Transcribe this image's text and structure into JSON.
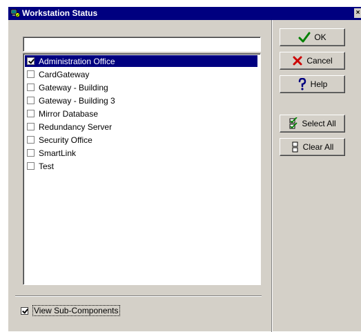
{
  "window": {
    "title": "Workstation Status",
    "close_glyph": "×"
  },
  "search": {
    "value": "",
    "placeholder": ""
  },
  "items": [
    {
      "label": "Administration Office",
      "checked": true,
      "selected": true
    },
    {
      "label": "CardGateway",
      "checked": false,
      "selected": false
    },
    {
      "label": "Gateway - Building",
      "checked": false,
      "selected": false
    },
    {
      "label": "Gateway - Building 3",
      "checked": false,
      "selected": false
    },
    {
      "label": "Mirror Database",
      "checked": false,
      "selected": false
    },
    {
      "label": "Redundancy Server",
      "checked": false,
      "selected": false
    },
    {
      "label": "Security Office",
      "checked": false,
      "selected": false
    },
    {
      "label": "SmartLink",
      "checked": false,
      "selected": false
    },
    {
      "label": "Test",
      "checked": false,
      "selected": false
    }
  ],
  "sub_components": {
    "label": "View Sub-Components",
    "checked": true
  },
  "buttons": {
    "ok": {
      "label": "OK",
      "icon": "checkmark-icon",
      "icon_color": "#008000"
    },
    "cancel": {
      "label": "Cancel",
      "icon": "x-icon",
      "icon_color": "#cc0000"
    },
    "help": {
      "label": "Help",
      "icon": "question-mark-icon",
      "icon_color": "#000080"
    },
    "select_all": {
      "label": "Select All",
      "icon": "select-all-icon",
      "icon_color": "#008000"
    },
    "clear_all": {
      "label": "Clear All",
      "icon": "clear-all-icon",
      "icon_color": "#000000"
    }
  },
  "colors": {
    "title_bar": "#000080",
    "selection": "#000080",
    "face": "#d4d0c8"
  }
}
